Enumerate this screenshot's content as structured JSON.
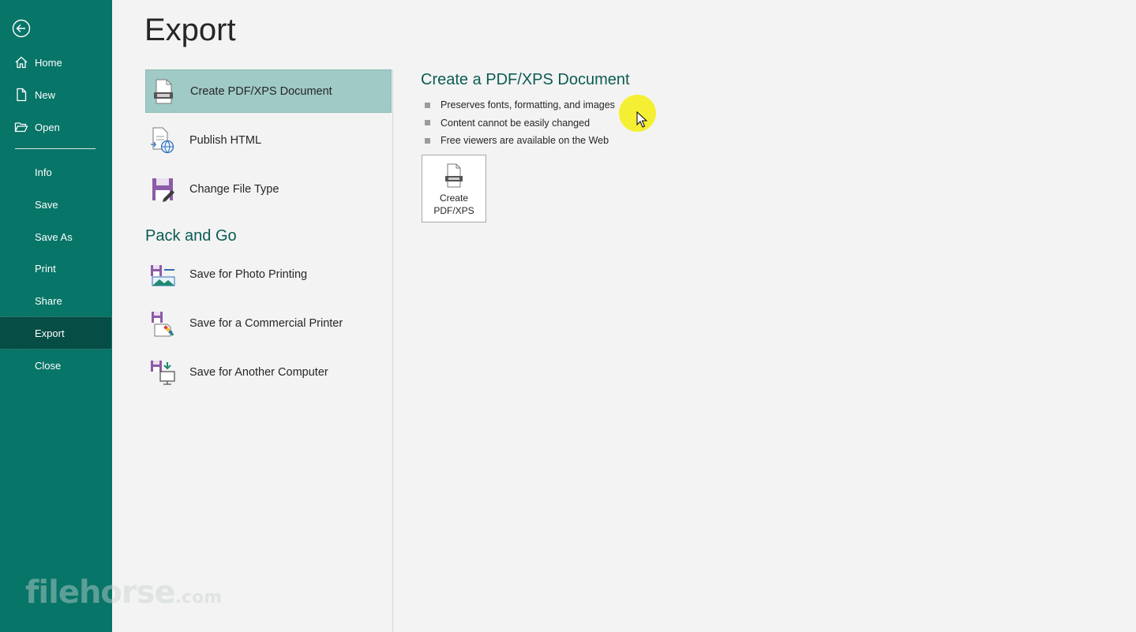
{
  "sidebar": {
    "back_label": "Back",
    "items": [
      {
        "label": "Home",
        "icon": "home-icon"
      },
      {
        "label": "New",
        "icon": "new-document-icon"
      },
      {
        "label": "Open",
        "icon": "open-folder-icon"
      },
      {
        "label": "Info"
      },
      {
        "label": "Save"
      },
      {
        "label": "Save As"
      },
      {
        "label": "Print"
      },
      {
        "label": "Share"
      },
      {
        "label": "Export",
        "selected": true
      },
      {
        "label": "Close"
      }
    ],
    "watermark": {
      "main": "filehorse",
      "tld": ".com"
    }
  },
  "main": {
    "title": "Export",
    "options": [
      {
        "label": "Create PDF/XPS Document",
        "icon": "pdf-document-icon",
        "selected": true
      },
      {
        "label": "Publish HTML",
        "icon": "publish-html-icon"
      },
      {
        "label": "Change File Type",
        "icon": "change-file-type-icon"
      }
    ],
    "pack_heading": "Pack and Go",
    "pack_options": [
      {
        "label": "Save for Photo Printing",
        "icon": "photo-printing-icon"
      },
      {
        "label": "Save for a Commercial Printer",
        "icon": "commercial-printer-icon"
      },
      {
        "label": "Save for Another Computer",
        "icon": "another-computer-icon"
      }
    ]
  },
  "detail": {
    "title": "Create a PDF/XPS Document",
    "bullets": [
      "Preserves fonts, formatting, and images",
      "Content cannot be easily changed",
      "Free viewers are available on the Web"
    ],
    "button_line1": "Create",
    "button_line2": "PDF/XPS"
  },
  "colors": {
    "sidebar_bg": "#077568",
    "sidebar_selected": "#054d45",
    "accent_heading": "#0b5c53",
    "option_selected": "#9fcac5",
    "cursor_highlight": "#f5ee1e"
  }
}
